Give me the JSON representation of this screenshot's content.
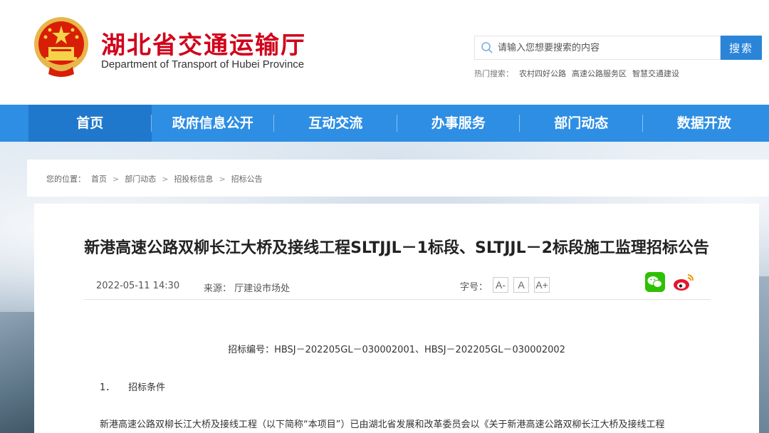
{
  "header": {
    "title": "湖北省交通运输厅",
    "subtitle": "Department of Transport of Hubei Province",
    "search_placeholder": "请输入您想要搜索的内容",
    "search_button": "搜索",
    "hot_label": "热门搜索：",
    "hot_items": [
      "农村四好公路",
      "高速公路服务区",
      "智慧交通建设"
    ]
  },
  "nav": {
    "items": [
      "首页",
      "政府信息公开",
      "互动交流",
      "办事服务",
      "部门动态",
      "数据开放"
    ],
    "active_index": 0
  },
  "breadcrumb": {
    "label": "您的位置：",
    "items": [
      "首页",
      "部门动态",
      "招投标信息",
      "招标公告"
    ],
    "separator": ">"
  },
  "article": {
    "title": "新港高速公路双柳长江大桥及接线工程SLTJJL－1标段、SLTJJL－2标段施工监理招标公告",
    "date": "2022-05-11 14:30",
    "source": "来源：  厅建设市场处",
    "font_size_label": "字号：",
    "font_size_options": [
      "A-",
      "A",
      "A+"
    ],
    "bid_number": "招标编号：HBSJ－202205GL－030002001、HBSJ－202205GL－030002002",
    "section_number": "1．",
    "section_title": "招标条件",
    "paragraph": "新港高速公路双柳长江大桥及接线工程（以下简称“本项目”）已由湖北省发展和改革委员会以《关于新港高速公路双柳长江大桥及接线工程"
  },
  "colors": {
    "title_red": "#d0021b",
    "nav_blue": "#2e8ee3",
    "nav_active": "#1f78cc",
    "search_blue": "#2a84d8",
    "wechat_green": "#2dc100",
    "weibo_red": "#e6162d"
  },
  "icons": {
    "emblem": "national-emblem",
    "search": "search-icon",
    "wechat": "wechat-icon",
    "weibo": "weibo-icon"
  }
}
